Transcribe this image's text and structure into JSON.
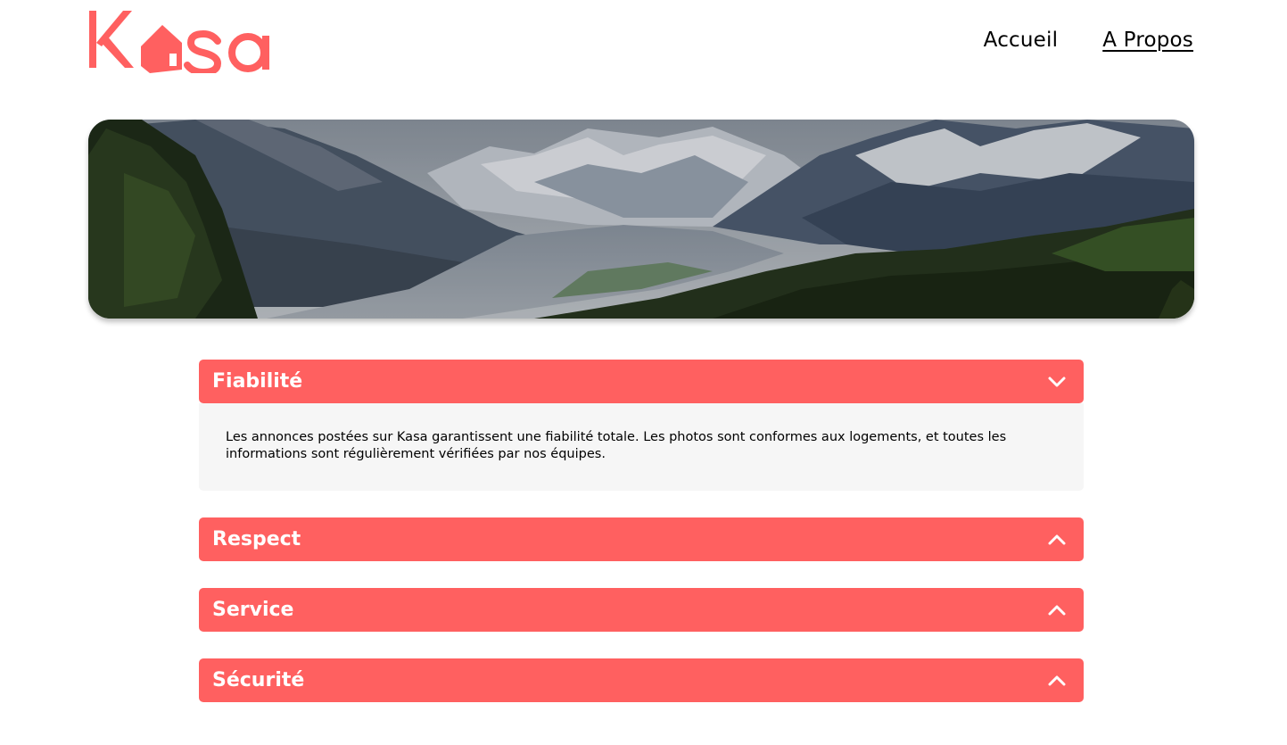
{
  "brand": {
    "name": "Kasa",
    "color": "#FF6060"
  },
  "nav": {
    "items": [
      {
        "label": "Accueil",
        "active": false
      },
      {
        "label": "A Propos",
        "active": true
      }
    ]
  },
  "banner": {
    "image": "mountain-valley-landscape"
  },
  "accordion": {
    "items": [
      {
        "title": "Fiabilité",
        "expanded": true,
        "icon": "chevron-down-icon",
        "content": "Les annonces postées sur Kasa garantissent une fiabilité totale. Les photos sont conformes aux logements, et toutes les informations sont régulièrement vérifiées par nos équipes."
      },
      {
        "title": "Respect",
        "expanded": false,
        "icon": "chevron-up-icon"
      },
      {
        "title": "Service",
        "expanded": false,
        "icon": "chevron-up-icon"
      },
      {
        "title": "Sécurité",
        "expanded": false,
        "icon": "chevron-up-icon"
      }
    ]
  },
  "colors": {
    "accent": "#FF6060",
    "panel": "#F6F6F6",
    "text": "#000000"
  }
}
